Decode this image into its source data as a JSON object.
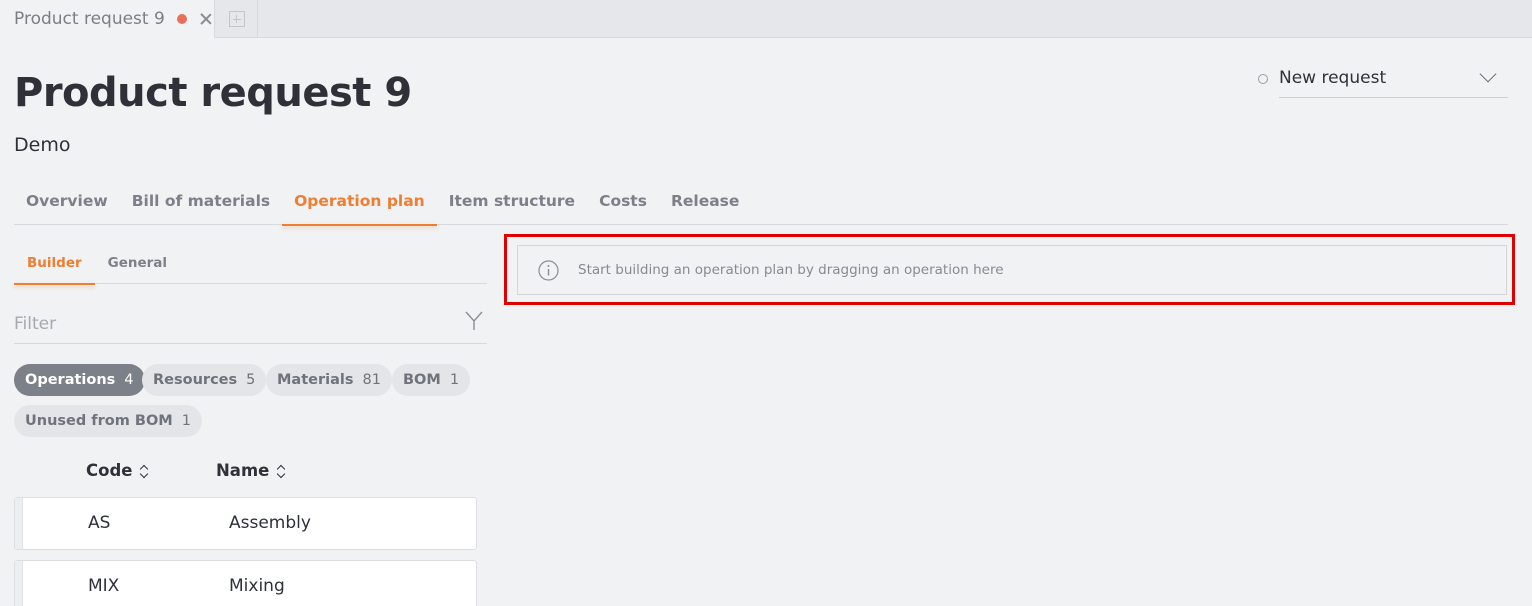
{
  "tabbar": {
    "doc_tab_title": "Product request 9",
    "colors": {
      "dirty_dot": "#e8705a"
    }
  },
  "header": {
    "title": "Product request 9",
    "subtitle": "Demo",
    "status_value": "New request"
  },
  "main_tabs": [
    {
      "label": "Overview",
      "active": false
    },
    {
      "label": "Bill of materials",
      "active": false
    },
    {
      "label": "Operation plan",
      "active": true
    },
    {
      "label": "Item structure",
      "active": false
    },
    {
      "label": "Costs",
      "active": false
    },
    {
      "label": "Release",
      "active": false
    }
  ],
  "sub_tabs": [
    {
      "label": "Builder",
      "active": true
    },
    {
      "label": "General",
      "active": false
    }
  ],
  "filter": {
    "placeholder": "Filter",
    "value": ""
  },
  "chips": [
    {
      "label": "Operations",
      "count": "4",
      "active": true
    },
    {
      "label": "Resources",
      "count": "5",
      "active": false
    },
    {
      "label": "Materials",
      "count": "81",
      "active": false
    },
    {
      "label": "BOM",
      "count": "1",
      "active": false
    },
    {
      "label": "Unused from BOM",
      "count": "1",
      "active": false
    }
  ],
  "table": {
    "columns": [
      "Code",
      "Name"
    ],
    "rows": [
      {
        "code": "AS",
        "name": "Assembly"
      },
      {
        "code": "MIX",
        "name": "Mixing"
      }
    ]
  },
  "drop_zone": {
    "message": "Start building an operation plan by dragging an operation here"
  },
  "theme": {
    "accent": "#ef7d32",
    "highlight": "#e00000",
    "background": "#f1f2f4"
  }
}
